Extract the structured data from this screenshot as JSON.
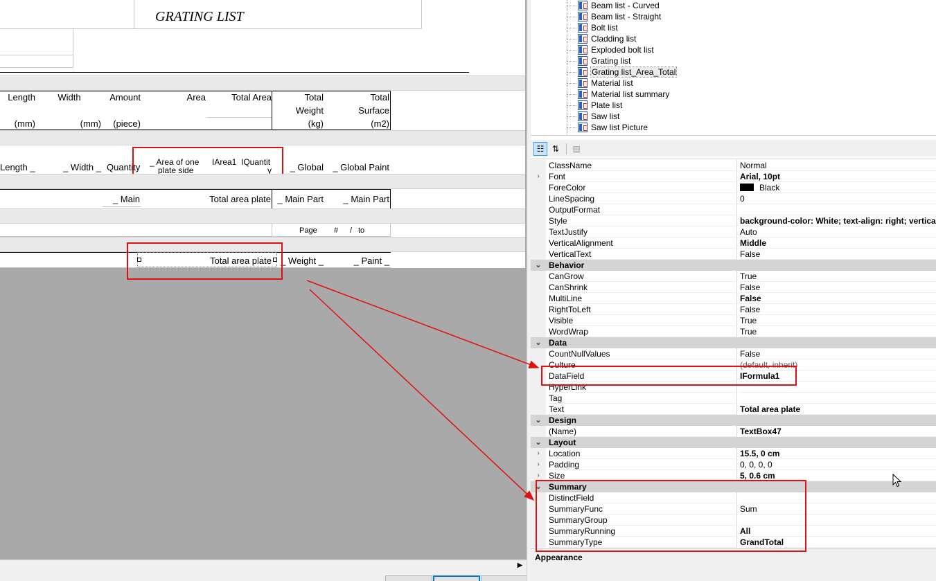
{
  "report": {
    "title": "GRATING LIST",
    "headers": {
      "length": [
        "Length",
        "(mm)"
      ],
      "width": [
        "Width",
        "(mm)"
      ],
      "amount": [
        "Amount",
        "(piece)"
      ],
      "area": "Area",
      "total_area": "Total Area",
      "total_weight": [
        "Total",
        "Weight",
        "(kg)"
      ],
      "total_surface": [
        "Total",
        "Surface",
        "(m2)"
      ]
    },
    "detail": {
      "length": "Length _",
      "width": "_ Width _",
      "quantity": "Quantity",
      "area_one_side": [
        "_ Area of one",
        "plate side"
      ],
      "iarea": "IArea1",
      "iquantity": [
        "IQuantit",
        "y"
      ],
      "global": "_ Global",
      "global_paint": "_ Global Paint"
    },
    "group_footer": {
      "main": "_ Main",
      "total_area_plate": "Total area plate",
      "main_part_1": "_ Main Part",
      "main_part_2": "_ Main Part"
    },
    "page_footer": {
      "page": "Page",
      "hash": "#",
      "slash": "/",
      "to": "to"
    },
    "report_footer": {
      "total_area_plate": "Total area plate",
      "weight": "_ Weight _",
      "paint": "_ Paint _"
    }
  },
  "tree": {
    "items": [
      "Beam list - Curved",
      "Beam list - Straight",
      "Bolt list",
      "Cladding list",
      "Exploded bolt list",
      "Grating list",
      "Grating list_Area_Total",
      "Material list",
      "Material list summary",
      "Plate list",
      "Saw list",
      "Saw list Picture"
    ],
    "selected_index": 6
  },
  "property_grid": {
    "rows": [
      {
        "kind": "prop",
        "expand": "",
        "name": "ClassName",
        "value": "Normal",
        "bold": false
      },
      {
        "kind": "prop",
        "expand": "›",
        "name": "Font",
        "value": "Arial, 10pt",
        "bold": true
      },
      {
        "kind": "prop",
        "expand": "",
        "name": "ForeColor",
        "value": "Black",
        "bold": false,
        "swatch": "#000000"
      },
      {
        "kind": "prop",
        "expand": "",
        "name": "LineSpacing",
        "value": "0",
        "bold": false
      },
      {
        "kind": "prop",
        "expand": "",
        "name": "OutputFormat",
        "value": "",
        "bold": false
      },
      {
        "kind": "prop",
        "expand": "",
        "name": "Style",
        "value": "background-color: White; text-align: right; vertical",
        "bold": true
      },
      {
        "kind": "prop",
        "expand": "",
        "name": "TextJustify",
        "value": "Auto",
        "bold": false
      },
      {
        "kind": "prop",
        "expand": "",
        "name": "VerticalAlignment",
        "value": "Middle",
        "bold": true
      },
      {
        "kind": "prop",
        "expand": "",
        "name": "VerticalText",
        "value": "False",
        "bold": false
      },
      {
        "kind": "cat",
        "expand": "⌄",
        "name": "Behavior"
      },
      {
        "kind": "prop",
        "expand": "",
        "name": "CanGrow",
        "value": "True",
        "bold": false
      },
      {
        "kind": "prop",
        "expand": "",
        "name": "CanShrink",
        "value": "False",
        "bold": false
      },
      {
        "kind": "prop",
        "expand": "",
        "name": "MultiLine",
        "value": "False",
        "bold": true
      },
      {
        "kind": "prop",
        "expand": "",
        "name": "RightToLeft",
        "value": "False",
        "bold": false
      },
      {
        "kind": "prop",
        "expand": "",
        "name": "Visible",
        "value": "True",
        "bold": false
      },
      {
        "kind": "prop",
        "expand": "",
        "name": "WordWrap",
        "value": "True",
        "bold": false
      },
      {
        "kind": "cat",
        "expand": "⌄",
        "name": "Data"
      },
      {
        "kind": "prop",
        "expand": "",
        "name": "CountNullValues",
        "value": "False",
        "bold": false
      },
      {
        "kind": "prop",
        "expand": "",
        "name": "Culture",
        "value": "(default, inherit)",
        "bold": false
      },
      {
        "kind": "prop",
        "expand": "",
        "name": "DataField",
        "value": "IFormula1",
        "bold": true
      },
      {
        "kind": "prop",
        "expand": "",
        "name": "HyperLink",
        "value": "",
        "bold": false
      },
      {
        "kind": "prop",
        "expand": "",
        "name": "Tag",
        "value": "",
        "bold": false
      },
      {
        "kind": "prop",
        "expand": "",
        "name": "Text",
        "value": "Total area plate",
        "bold": true
      },
      {
        "kind": "cat",
        "expand": "⌄",
        "name": "Design"
      },
      {
        "kind": "prop",
        "expand": "",
        "name": "(Name)",
        "value": "TextBox47",
        "bold": true
      },
      {
        "kind": "cat",
        "expand": "⌄",
        "name": "Layout"
      },
      {
        "kind": "prop",
        "expand": "›",
        "name": "Location",
        "value": "15.5, 0 cm",
        "bold": true
      },
      {
        "kind": "prop",
        "expand": "›",
        "name": "Padding",
        "value": "0, 0, 0, 0",
        "bold": false
      },
      {
        "kind": "prop",
        "expand": "›",
        "name": "Size",
        "value": "5, 0.6 cm",
        "bold": true
      },
      {
        "kind": "cat",
        "expand": "⌄",
        "name": "Summary"
      },
      {
        "kind": "prop",
        "expand": "",
        "name": "DistinctField",
        "value": "",
        "bold": false
      },
      {
        "kind": "prop",
        "expand": "",
        "name": "SummaryFunc",
        "value": "Sum",
        "bold": false
      },
      {
        "kind": "prop",
        "expand": "",
        "name": "SummaryGroup",
        "value": "",
        "bold": false
      },
      {
        "kind": "prop",
        "expand": "",
        "name": "SummaryRunning",
        "value": "All",
        "bold": true
      },
      {
        "kind": "prop",
        "expand": "",
        "name": "SummaryType",
        "value": "GrandTotal",
        "bold": true
      }
    ],
    "description_title": "Appearance"
  },
  "colors": {
    "highlight": "#e01010",
    "category_bg": "#d4d4d4",
    "canvas_bg": "#a9a9a9"
  }
}
